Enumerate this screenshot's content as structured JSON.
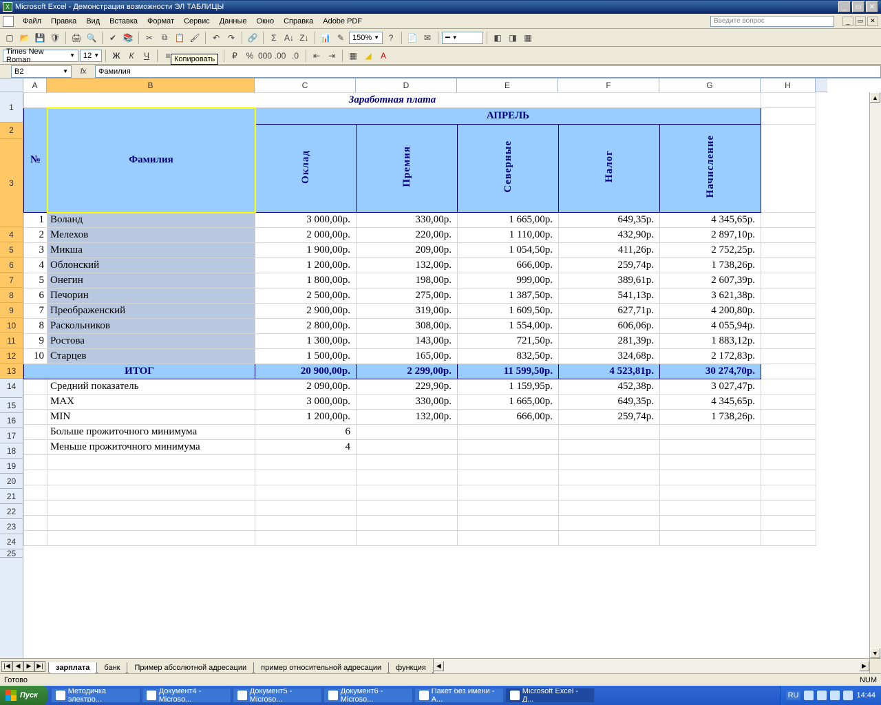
{
  "title": "Microsoft Excel - Демонстрация возможности ЭЛ ТАБЛИЦЫ",
  "menu": [
    "Файл",
    "Правка",
    "Вид",
    "Вставка",
    "Формат",
    "Сервис",
    "Данные",
    "Окно",
    "Справка",
    "Adobe PDF"
  ],
  "question_placeholder": "Введите вопрос",
  "tooltip_copy": "Копировать",
  "font_name": "Times New Roman",
  "font_size": "12",
  "zoom": "150%",
  "namebox": "B2",
  "formula": "Фамилия",
  "columns": [
    "A",
    "B",
    "C",
    "D",
    "E",
    "F",
    "G",
    "H"
  ],
  "row_numbers": [
    1,
    2,
    3,
    4,
    5,
    6,
    7,
    8,
    9,
    10,
    11,
    12,
    13,
    14,
    15,
    16,
    17,
    18,
    19,
    20,
    21,
    22,
    23,
    24,
    25
  ],
  "sheet": {
    "title": "Заработная плата",
    "month": "АПРЕЛЬ",
    "hdr_num": "№",
    "hdr_surname": "Фамилия",
    "hdr_cols": [
      "Оклад",
      "Премия",
      "Северные",
      "Налог",
      "Начисление"
    ],
    "rows": [
      {
        "n": 1,
        "name": "Воланд",
        "c": "3 000,00р.",
        "d": "330,00р.",
        "e": "1 665,00р.",
        "f": "649,35р.",
        "g": "4 345,65р."
      },
      {
        "n": 2,
        "name": "Мелехов",
        "c": "2 000,00р.",
        "d": "220,00р.",
        "e": "1 110,00р.",
        "f": "432,90р.",
        "g": "2 897,10р."
      },
      {
        "n": 3,
        "name": "Микша",
        "c": "1 900,00р.",
        "d": "209,00р.",
        "e": "1 054,50р.",
        "f": "411,26р.",
        "g": "2 752,25р."
      },
      {
        "n": 4,
        "name": "Облонский",
        "c": "1 200,00р.",
        "d": "132,00р.",
        "e": "666,00р.",
        "f": "259,74р.",
        "g": "1 738,26р."
      },
      {
        "n": 5,
        "name": "Онегин",
        "c": "1 800,00р.",
        "d": "198,00р.",
        "e": "999,00р.",
        "f": "389,61р.",
        "g": "2 607,39р."
      },
      {
        "n": 6,
        "name": "Печорин",
        "c": "2 500,00р.",
        "d": "275,00р.",
        "e": "1 387,50р.",
        "f": "541,13р.",
        "g": "3 621,38р."
      },
      {
        "n": 7,
        "name": "Преображенский",
        "c": "2 900,00р.",
        "d": "319,00р.",
        "e": "1 609,50р.",
        "f": "627,71р.",
        "g": "4 200,80р."
      },
      {
        "n": 8,
        "name": "Раскольников",
        "c": "2 800,00р.",
        "d": "308,00р.",
        "e": "1 554,00р.",
        "f": "606,06р.",
        "g": "4 055,94р."
      },
      {
        "n": 9,
        "name": "Ростова",
        "c": "1 300,00р.",
        "d": "143,00р.",
        "e": "721,50р.",
        "f": "281,39р.",
        "g": "1 883,12р."
      },
      {
        "n": 10,
        "name": "Старцев",
        "c": "1 500,00р.",
        "d": "165,00р.",
        "e": "832,50р.",
        "f": "324,68р.",
        "g": "2 172,83р."
      }
    ],
    "itog_label": "ИТОГ",
    "itog": {
      "c": "20 900,00р.",
      "d": "2 299,00р.",
      "e": "11 599,50р.",
      "f": "4 523,81р.",
      "g": "30 274,70р."
    },
    "stats": [
      {
        "label": "Средний показатель",
        "c": "2 090,00р.",
        "d": "229,90р.",
        "e": "1 159,95р.",
        "f": "452,38р.",
        "g": "3 027,47р."
      },
      {
        "label": "MAX",
        "c": "3 000,00р.",
        "d": "330,00р.",
        "e": "1 665,00р.",
        "f": "649,35р.",
        "g": "4 345,65р."
      },
      {
        "label": "MIN",
        "c": "1 200,00р.",
        "d": "132,00р.",
        "e": "666,00р.",
        "f": "259,74р.",
        "g": "1 738,26р."
      }
    ],
    "extra": [
      {
        "label": "Больше прожиточного минимума",
        "val": "6"
      },
      {
        "label": "Меньше прожиточного минимума",
        "val": "4"
      }
    ]
  },
  "sheet_tabs": [
    "зарплата",
    "банк",
    "Пример абсолютной адресации",
    "пример относительной адресации",
    "функция"
  ],
  "status_ready": "Готово",
  "status_num": "NUM",
  "taskbar": {
    "start": "Пуск",
    "items": [
      "Методичка электро...",
      "Документ4 - Microso...",
      "Документ5 - Microso...",
      "Документ6 - Microso...",
      "Пакет без имени - A...",
      "Microsoft Excel - Д..."
    ],
    "lang": "RU",
    "time": "14:44"
  }
}
